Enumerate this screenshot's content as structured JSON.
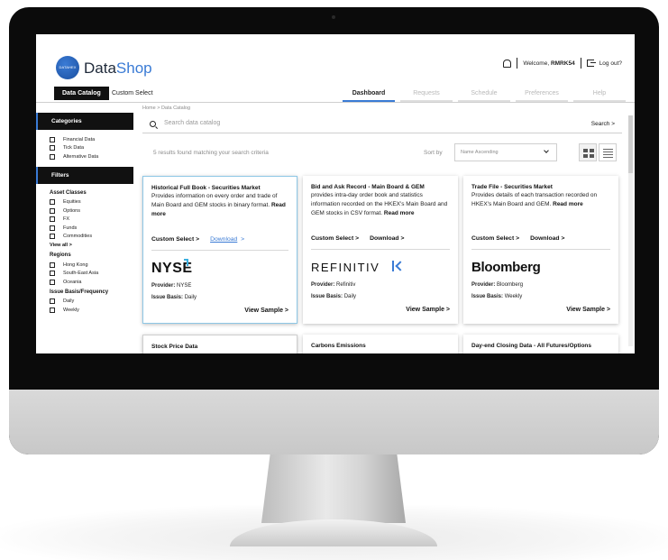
{
  "header": {
    "logo_badge": "DATAHEX",
    "logo_part1": "Data",
    "logo_part2": "Shop",
    "welcome": "Welcome, ",
    "username": "RMRK54",
    "logout": "Log out?"
  },
  "nav": {
    "catalog": "Data Catalog",
    "custom_select": "Custom Select",
    "tabs": [
      "Dashboard",
      "Requests",
      "Schedule",
      "Preferences",
      "Help"
    ]
  },
  "breadcrumb": "Home  >  Data Catalog",
  "sidebar": {
    "categories_title": "Categories",
    "categories": [
      "Financial Data",
      "Tick Data",
      "Alternative Data"
    ],
    "filters_title": "Filters",
    "asset_classes_title": "Asset Classes",
    "asset_classes": [
      "Equities",
      "Options",
      "FX",
      "Funds",
      "Commodities"
    ],
    "view_all": "View all  >",
    "regions_title": "Regions",
    "regions": [
      "Hong Kong",
      "South-East Asia",
      "Oceania"
    ],
    "frequency_title": "Issue Basis/Frequency",
    "frequency": [
      "Daily",
      "Weekly"
    ]
  },
  "search": {
    "placeholder": "Search data catalog",
    "button": "Search  >"
  },
  "results_text": "5 results found matching your search criteria",
  "sort": {
    "label": "Sort by",
    "value": "Name Ascending"
  },
  "cards": [
    {
      "title": "Historical Full Book - Securities Market",
      "desc": "Provides information on every order and trade of Main Board and GEM stocks in binary format. ",
      "read_more": "Read more",
      "custom_select": "Custom Select  >",
      "download": "Download",
      "download_arrow": ">",
      "brand": "NYSE",
      "provider_label": "Provider: ",
      "provider": "NYSE",
      "basis_label": "Issue Basis: ",
      "basis": "Daily",
      "view_sample": "View Sample  >"
    },
    {
      "title": "Bid and Ask Record - Main Board & GEM",
      "desc": "provides intra-day order book and statistics information recorded on the HKEX's Main Board and GEM stocks in CSV format. ",
      "read_more": "Read more",
      "custom_select": "Custom Select  >",
      "download": "Download  >",
      "brand": "REFINITIV",
      "provider_label": "Provider: ",
      "provider": "Refinitiv",
      "basis_label": "Issue Basis: ",
      "basis": "Daily",
      "view_sample": "View Sample  >"
    },
    {
      "title": "Trade File - Securities Market",
      "desc": "Provides details of each transaction recorded on HKEX's Main Board and GEM. ",
      "read_more": "Read more",
      "custom_select": "Custom Select  >",
      "download": "Download  >",
      "brand": "Bloomberg",
      "provider_label": "Provider: ",
      "provider": "Bloomberg",
      "basis_label": "Issue Basis: ",
      "basis": "Weekly",
      "view_sample": "View Sample  >"
    }
  ],
  "more_cards": [
    "Stock Price Data",
    "Carbons Emissions",
    "Day-end Closing Data - All Futures/Options"
  ],
  "colors": {
    "accent": "#3a7bd5",
    "dark": "#111111",
    "highlight_border": "#8ec7e6"
  }
}
